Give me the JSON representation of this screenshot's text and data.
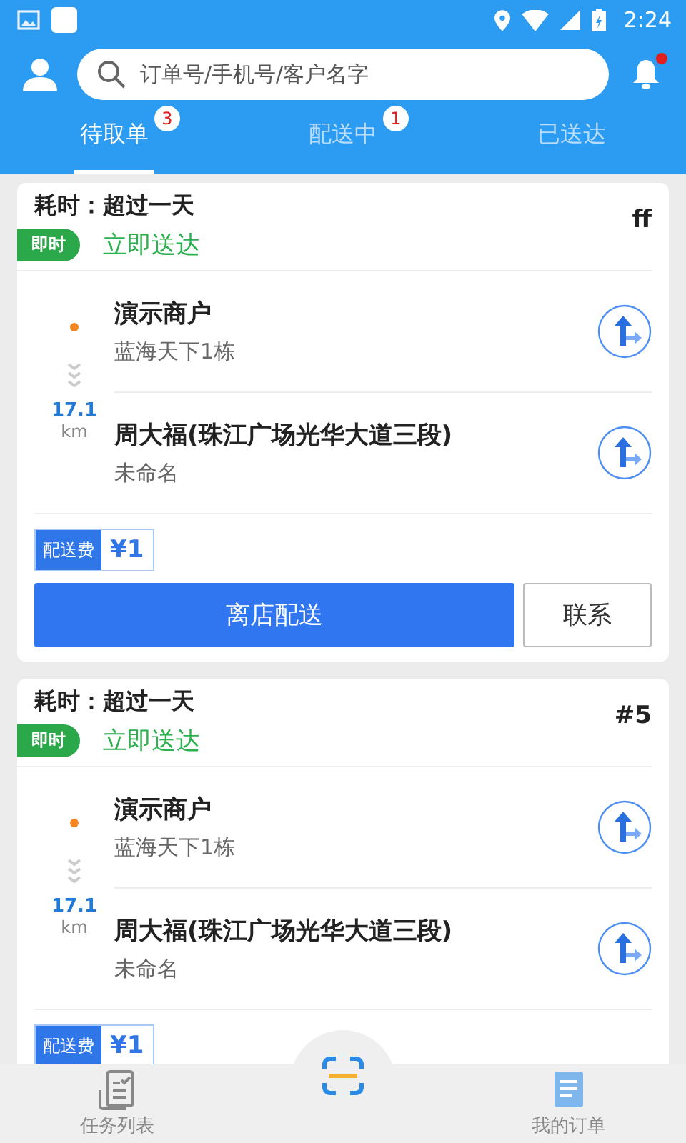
{
  "status_bar": {
    "time": "2:24"
  },
  "search": {
    "placeholder": "订单号/手机号/客户名字"
  },
  "notifications": {
    "unread": true
  },
  "tabs": [
    {
      "label": "待取单",
      "badge": "3",
      "selected": true
    },
    {
      "label": "配送中",
      "badge": "1",
      "selected": false
    },
    {
      "label": "已送达",
      "selected": false
    }
  ],
  "orders": [
    {
      "elapsed": "耗时：超过一天",
      "number": "ff",
      "tag": "即时",
      "delivery": "立即送达",
      "distance": "17.1",
      "unit": "km",
      "stops": [
        {
          "name": "演示商户",
          "address": "蓝海天下1栋"
        },
        {
          "name": "周大福(珠江广场光华大道三段)",
          "address": "未命名"
        }
      ],
      "fee_label": "配送费",
      "fee": "¥1",
      "primary_action": "离店配送",
      "secondary_action": "联系"
    },
    {
      "elapsed": "耗时：超过一天",
      "number": "#5",
      "tag": "即时",
      "delivery": "立即送达",
      "distance": "17.1",
      "unit": "km",
      "stops": [
        {
          "name": "演示商户",
          "address": "蓝海天下1栋"
        },
        {
          "name": "周大福(珠江广场光华大道三段)",
          "address": "未命名"
        }
      ],
      "fee_label": "配送费",
      "fee": "¥1"
    }
  ],
  "bottom_nav": [
    {
      "label": "任务列表",
      "kind": "tasks",
      "selected": false
    },
    {
      "kind": "scan"
    },
    {
      "label": "我的订单",
      "kind": "orders",
      "selected": false
    }
  ]
}
